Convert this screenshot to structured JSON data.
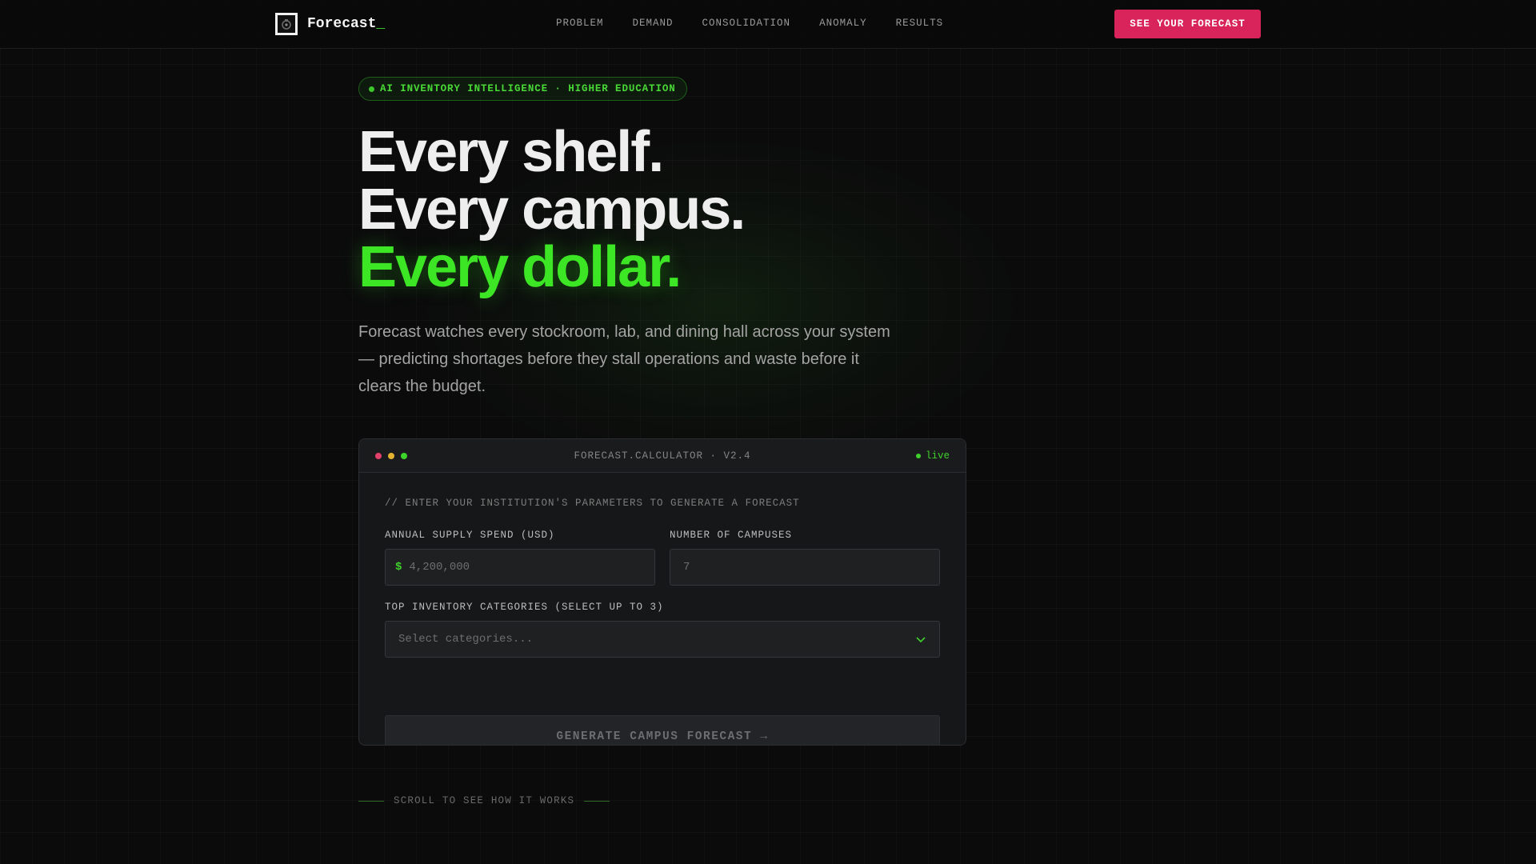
{
  "nav": {
    "brand": "Forecast",
    "brand_cursor": "_",
    "links": [
      "PROBLEM",
      "DEMAND",
      "CONSOLIDATION",
      "ANOMALY",
      "RESULTS"
    ],
    "cta_label": "SEE YOUR FORECAST"
  },
  "hero": {
    "badge": "AI INVENTORY INTELLIGENCE · HIGHER EDUCATION",
    "headline": [
      "Every shelf.",
      "Every campus.",
      "Every dollar."
    ],
    "lead": "Forecast watches every stockroom, lab, and dining hall across your system — predicting shortages before they stall operations and waste before it clears the budget."
  },
  "calculator": {
    "title": "FORECAST.CALCULATOR · V2.4",
    "status": "live",
    "comment": "// ENTER YOUR INSTITUTION'S PARAMETERS TO GENERATE A FORECAST",
    "spend": {
      "label": "ANNUAL SUPPLY SPEND (USD)",
      "currency": "$",
      "placeholder": "4,200,000"
    },
    "campuses": {
      "label": "NUMBER OF CAMPUSES",
      "placeholder": "7"
    },
    "categories": {
      "label": "TOP INVENTORY CATEGORIES (SELECT UP TO 3)",
      "placeholder": "Select categories..."
    },
    "submit_label": "GENERATE CAMPUS FORECAST →"
  },
  "scroll_hint": "SCROLL TO SEE HOW IT WORKS",
  "colors": {
    "accent_green": "#3de625",
    "cta_pink": "#d8245a",
    "background": "#0b0b0c"
  },
  "icons": {
    "logo": "logo-mark-icon",
    "status": "live-dot-icon",
    "dropdown": "chevron-down-icon"
  }
}
